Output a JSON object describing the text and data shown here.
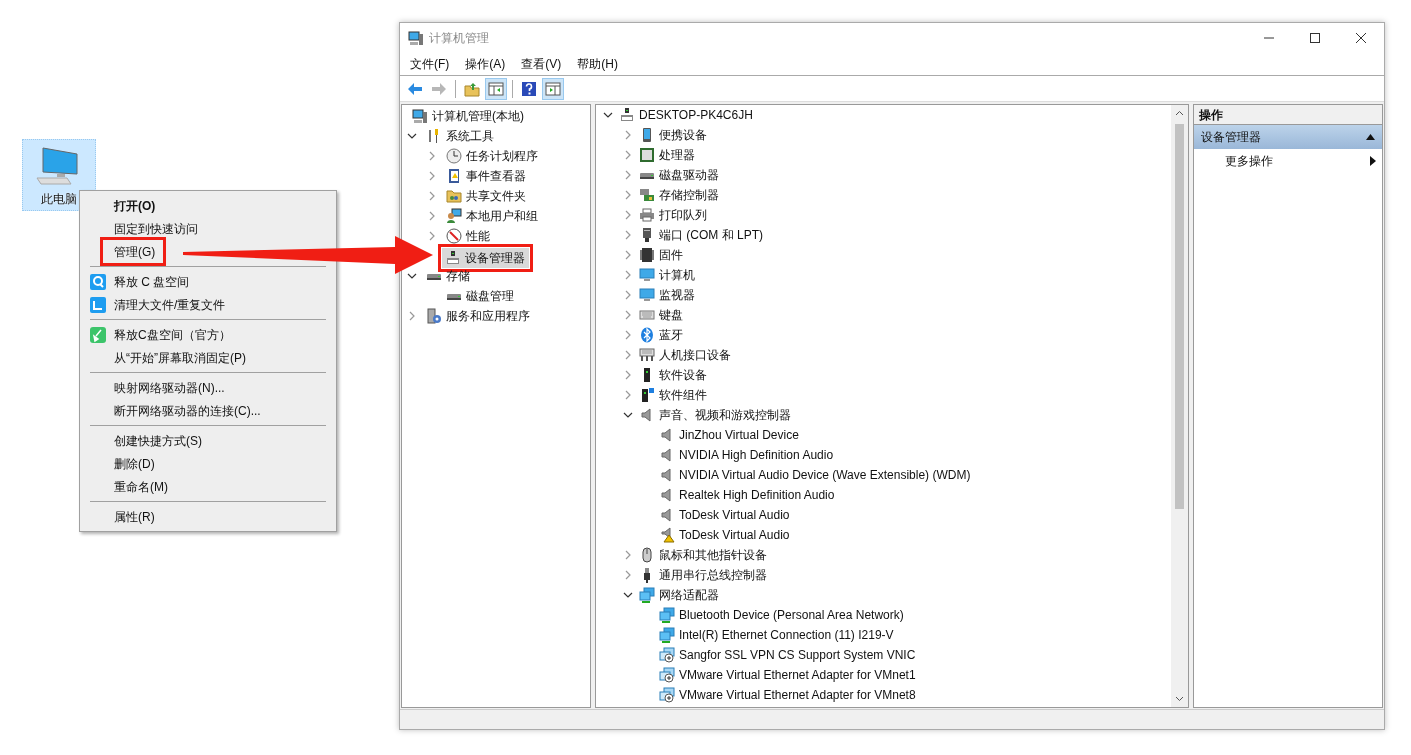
{
  "desktop_icon": {
    "label": "此电脑",
    "selected": true
  },
  "context_menu": {
    "groups": [
      [
        {
          "label": "打开(O)",
          "default": true,
          "highlighted": false
        },
        {
          "label": "固定到快速访问",
          "default": false,
          "highlighted": false
        },
        {
          "label": "管理(G)",
          "default": false,
          "highlighted": true
        }
      ],
      [
        {
          "label": "释放 C 盘空间",
          "default": false,
          "highlighted": false
        },
        {
          "label": "清理大文件/重复文件",
          "default": false,
          "highlighted": false
        }
      ],
      [
        {
          "label": "释放C盘空间（官方）",
          "default": false,
          "highlighted": false
        },
        {
          "label": "从“开始”屏幕取消固定(P)",
          "default": false,
          "highlighted": false
        }
      ],
      [
        {
          "label": "映射网络驱动器(N)...",
          "default": false,
          "highlighted": false
        },
        {
          "label": "断开网络驱动器的连接(C)...",
          "default": false,
          "highlighted": false
        }
      ],
      [
        {
          "label": "创建快捷方式(S)",
          "default": false,
          "highlighted": false
        },
        {
          "label": "删除(D)",
          "default": false,
          "highlighted": false
        },
        {
          "label": "重命名(M)",
          "default": false,
          "highlighted": false
        }
      ],
      [
        {
          "label": "属性(R)",
          "default": false,
          "highlighted": false
        }
      ]
    ]
  },
  "window": {
    "title": "计算机管理",
    "menu": [
      "文件(F)",
      "操作(A)",
      "查看(V)",
      "帮助(H)"
    ],
    "toolbar": [
      {
        "pressed": false,
        "disabled": false
      },
      {
        "pressed": false,
        "disabled": true
      },
      {
        "pressed": false,
        "disabled": false
      },
      {
        "pressed": true,
        "disabled": false
      },
      {
        "pressed": false,
        "disabled": false
      },
      {
        "pressed": true,
        "disabled": false
      }
    ],
    "nav_tree": [
      {
        "label": "计算机管理(本地)",
        "selected": false,
        "highlighted": false,
        "children": [
          {
            "label": "系统工具",
            "expanded": true,
            "selected": false,
            "highlighted": false,
            "children": [
              {
                "label": "任务计划程序",
                "expanded": false,
                "selected": false,
                "highlighted": false
              },
              {
                "label": "事件查看器",
                "expanded": false,
                "selected": false,
                "highlighted": false
              },
              {
                "label": "共享文件夹",
                "expanded": false,
                "selected": false,
                "highlighted": false
              },
              {
                "label": "本地用户和组",
                "expanded": false,
                "selected": false,
                "highlighted": false
              },
              {
                "label": "性能",
                "expanded": false,
                "selected": false,
                "highlighted": false
              },
              {
                "label": "设备管理器",
                "selected": true,
                "highlighted": true
              }
            ]
          },
          {
            "label": "存储",
            "expanded": true,
            "selected": false,
            "highlighted": false,
            "children": [
              {
                "label": "磁盘管理",
                "selected": false,
                "highlighted": false
              }
            ]
          },
          {
            "label": "服务和应用程序",
            "expanded": false,
            "selected": false,
            "highlighted": false
          }
        ]
      }
    ],
    "device_tree": {
      "label": "DESKTOP-PK4C6JH",
      "expanded": true,
      "children": [
        {
          "label": "便携设备",
          "expanded": false
        },
        {
          "label": "处理器",
          "expanded": false
        },
        {
          "label": "磁盘驱动器",
          "expanded": false
        },
        {
          "label": "存储控制器",
          "expanded": false
        },
        {
          "label": "打印队列",
          "expanded": false
        },
        {
          "label": "端口 (COM 和 LPT)",
          "expanded": false
        },
        {
          "label": "固件",
          "expanded": false
        },
        {
          "label": "计算机",
          "expanded": false
        },
        {
          "label": "监视器",
          "expanded": false
        },
        {
          "label": "键盘",
          "expanded": false
        },
        {
          "label": "蓝牙",
          "expanded": false
        },
        {
          "label": "人机接口设备",
          "expanded": false
        },
        {
          "label": "软件设备",
          "expanded": false
        },
        {
          "label": "软件组件",
          "expanded": false
        },
        {
          "label": "声音、视频和游戏控制器",
          "expanded": true,
          "children": [
            {
              "label": "JinZhou Virtual Device",
              "warning": false
            },
            {
              "label": "NVIDIA High Definition Audio",
              "warning": false
            },
            {
              "label": "NVIDIA Virtual Audio Device (Wave Extensible) (WDM)",
              "warning": false
            },
            {
              "label": "Realtek High Definition Audio",
              "warning": false
            },
            {
              "label": "ToDesk Virtual Audio",
              "warning": false
            },
            {
              "label": "ToDesk Virtual Audio",
              "warning": true
            }
          ]
        },
        {
          "label": "鼠标和其他指针设备",
          "expanded": false
        },
        {
          "label": "通用串行总线控制器",
          "expanded": false
        },
        {
          "label": "网络适配器",
          "expanded": true,
          "children": [
            {
              "label": "Bluetooth Device (Personal Area Network)",
              "warning": false
            },
            {
              "label": "Intel(R) Ethernet Connection (11) I219-V",
              "warning": false
            },
            {
              "label": "Sangfor SSL VPN CS Support System VNIC",
              "warning": false
            },
            {
              "label": "VMware Virtual Ethernet Adapter for VMnet1",
              "warning": false
            },
            {
              "label": "VMware Virtual Ethernet Adapter for VMnet8",
              "warning": false
            }
          ]
        }
      ]
    },
    "actions": {
      "header": "操作",
      "section": {
        "label": "设备管理器",
        "expanded": true
      },
      "items": [
        {
          "label": "更多操作"
        }
      ]
    }
  }
}
